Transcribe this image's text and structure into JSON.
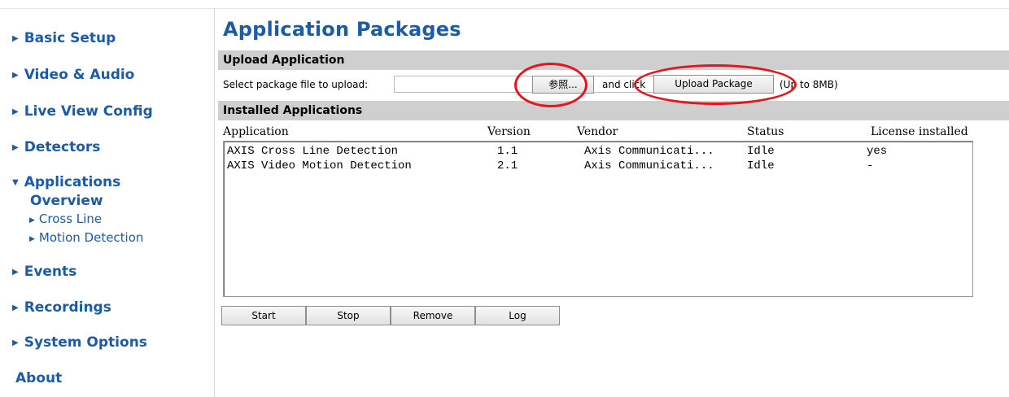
{
  "sidebar": {
    "items": [
      {
        "label": "Basic Setup"
      },
      {
        "label": "Video & Audio"
      },
      {
        "label": "Live View Config"
      },
      {
        "label": "Detectors"
      },
      {
        "label": "Applications"
      },
      {
        "label": "Events"
      },
      {
        "label": "Recordings"
      },
      {
        "label": "System Options"
      },
      {
        "label": "About"
      }
    ],
    "applications_sub": {
      "current": "Overview",
      "links": [
        "Cross Line",
        "Motion Detection"
      ]
    },
    "icons": {
      "collapsed": "triangle-right-icon",
      "expanded": "triangle-down-icon"
    }
  },
  "page": {
    "title": "Application Packages"
  },
  "upload": {
    "section_title": "Upload Application",
    "select_label": "Select package file to upload:",
    "browse_label": "参照...",
    "and_click": "and click",
    "upload_button": "Upload Package",
    "size_limit": "(Up to 8MB)"
  },
  "installed": {
    "section_title": "Installed Applications",
    "columns": [
      "Application",
      "Version",
      "Vendor",
      "Status",
      "License installed"
    ],
    "rows": [
      {
        "application": "AXIS Cross Line Detection",
        "version": "1.1",
        "vendor": "Axis Communicati...",
        "status": "Idle",
        "license": "yes"
      },
      {
        "application": "AXIS Video Motion Detection",
        "version": "2.1",
        "vendor": "Axis Communicati...",
        "status": "Idle",
        "license": "-"
      }
    ]
  },
  "actions": {
    "start": "Start",
    "stop": "Stop",
    "remove": "Remove",
    "log": "Log"
  },
  "colors": {
    "link": "#1c5ba8",
    "section_bar": "#cfcfcf",
    "highlight": "#e8141b"
  }
}
